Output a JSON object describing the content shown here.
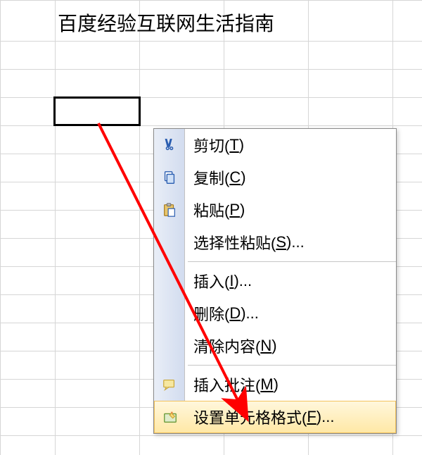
{
  "cell_content": "百度经验互联网生活指南",
  "context_menu": {
    "items": [
      {
        "label": "剪切",
        "hotkey": "T",
        "icon": "cut"
      },
      {
        "label": "复制",
        "hotkey": "C",
        "icon": "copy"
      },
      {
        "label": "粘贴",
        "hotkey": "P",
        "icon": "paste"
      },
      {
        "label": "选择性粘贴",
        "hotkey": "S",
        "suffix": "...",
        "icon": ""
      },
      {
        "sep": true
      },
      {
        "label": "插入",
        "hotkey": "I",
        "suffix": "...",
        "icon": ""
      },
      {
        "label": "删除",
        "hotkey": "D",
        "suffix": "...",
        "icon": ""
      },
      {
        "label": "清除内容",
        "hotkey": "N",
        "icon": ""
      },
      {
        "sep": true
      },
      {
        "label": "插入批注",
        "hotkey": "M",
        "icon": "comment"
      },
      {
        "label": "设置单元格格式",
        "hotkey": "F",
        "suffix": "...",
        "icon": "format",
        "highlight": true
      }
    ]
  }
}
